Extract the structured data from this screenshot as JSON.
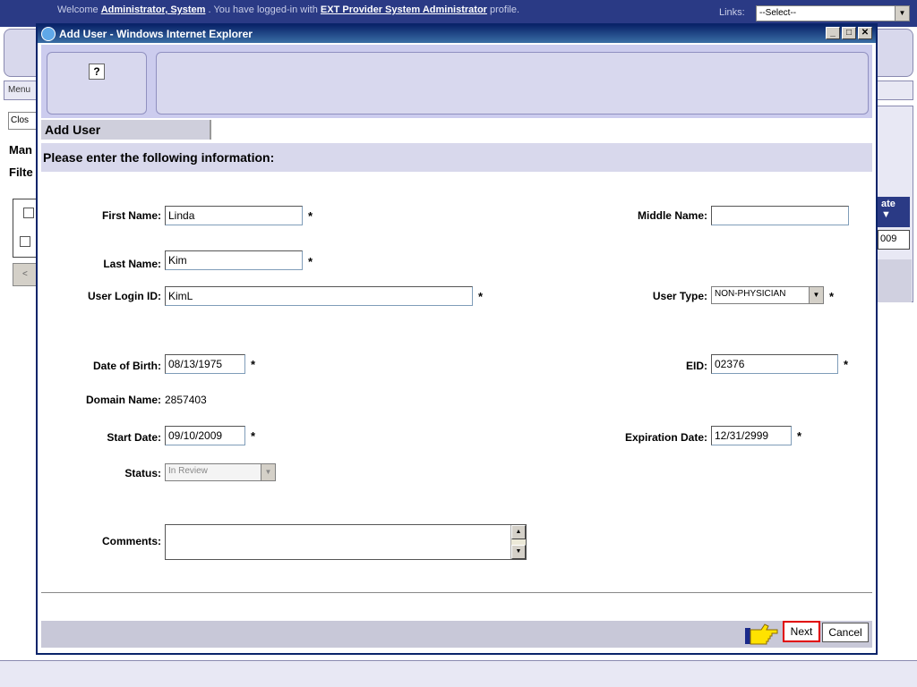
{
  "background": {
    "welcome_prefix": "Welcome ",
    "welcome_name": "Administrator, System",
    "welcome_mid": " . You have logged-in with ",
    "welcome_profile": "EXT Provider System Administrator",
    "welcome_suffix": " profile.",
    "links_label": "Links:",
    "links_select": "--Select--",
    "menu_label": "Menu",
    "close_label": "Clos",
    "man_text": "Man",
    "filte_text": "Filte",
    "right_header": "ate ▼",
    "right_cell": "009",
    "back_btn": "<"
  },
  "dialog": {
    "title": "Add User - Windows Internet Explorer",
    "help_label": "?",
    "tab_label": "Add User",
    "section_title": "Please enter the following information:"
  },
  "form": {
    "first_name_label": "First Name:",
    "first_name_value": "Linda",
    "middle_name_label": "Middle Name:",
    "middle_name_value": "",
    "last_name_label": "Last Name:",
    "last_name_value": "Kim",
    "login_label": "User Login ID:",
    "login_value": "KimL",
    "user_type_label": "User Type:",
    "user_type_value": "NON-PHYSICIAN",
    "dob_label": "Date of Birth:",
    "dob_value": "08/13/1975",
    "eid_label": "EID:",
    "eid_value": "02376",
    "domain_label": "Domain Name:",
    "domain_value": "2857403",
    "start_label": "Start Date:",
    "start_value": "09/10/2009",
    "exp_label": "Expiration Date:",
    "exp_value": "12/31/2999",
    "status_label": "Status:",
    "status_value": "In Review",
    "comments_label": "Comments:",
    "comments_value": "",
    "required_marker": "*"
  },
  "footer": {
    "next_label": "Next",
    "cancel_label": "Cancel"
  }
}
